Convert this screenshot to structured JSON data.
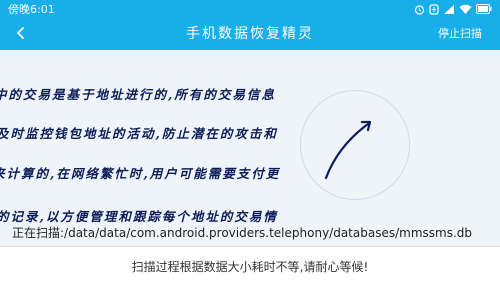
{
  "status_bar": {
    "time": "傍晚6:01",
    "icons": [
      "alarm-icon",
      "battery-saver-icon",
      "signal-icon",
      "wifi-icon",
      "battery-icon"
    ]
  },
  "header": {
    "title": "手机数据恢复精灵",
    "back_icon": "chevron-left-icon",
    "stop_label": "停止扫描"
  },
  "background_text": {
    "line1": "中的交易是基于地址进行的,所有的交易信息",
    "line2": "及时监控钱包地址的活动,防止潜在的攻击和",
    "line3": "来计算的,在网络繁忙时,用户可能需要支付更",
    "line4": "的记录,以方便管理和跟踪每个地址的交易情"
  },
  "scan": {
    "path_text": "正在扫描:/data/data/com.android.providers.telephony/databases/mmssms.db"
  },
  "footer": {
    "note": "扫描过程根据数据大小耗时不等,请耐心等候!"
  },
  "colors": {
    "accent": "#17aeea",
    "panel": "#ffffff"
  }
}
